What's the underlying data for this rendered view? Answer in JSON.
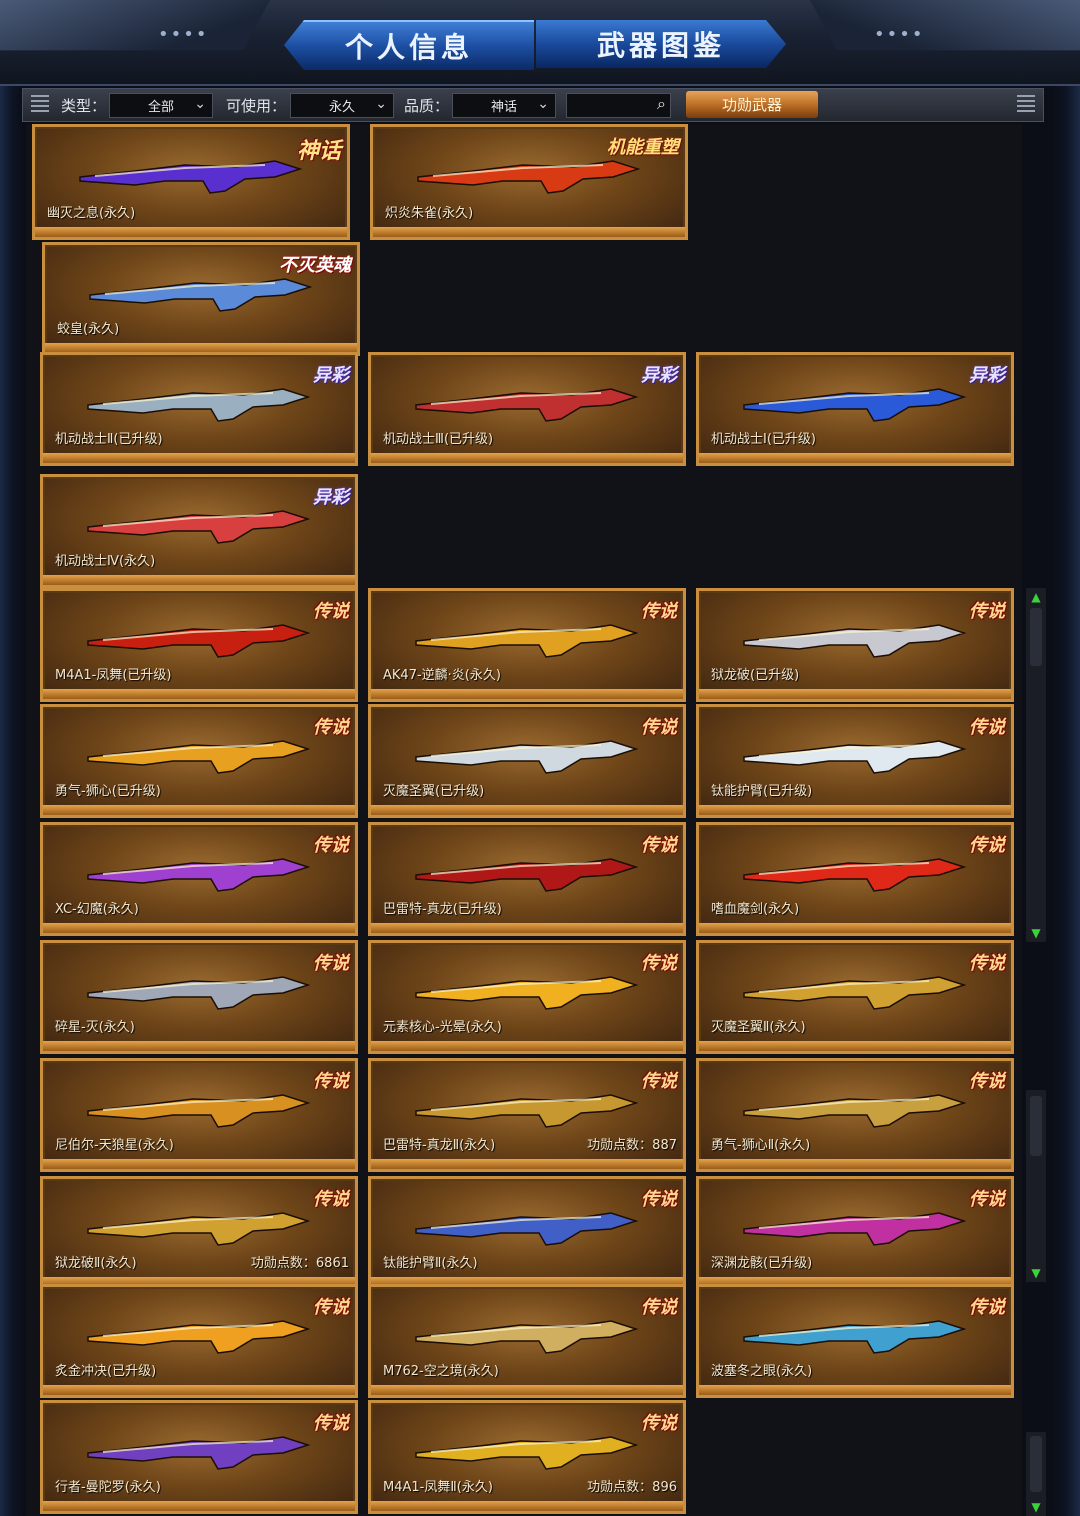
{
  "tabs": [
    {
      "label": "个人信息"
    },
    {
      "label": "武器图鉴"
    }
  ],
  "filters": {
    "type_label": "类型：",
    "type_value": "全部",
    "usable_label": "可使用：",
    "usable_value": "永久",
    "quality_label": "品质：",
    "quality_value": "神话",
    "search_value": "",
    "merit_button": "功勋武器"
  },
  "header_dots": "••••",
  "cards": [
    {
      "name": "幽灭之息(永久)",
      "badge": "神话",
      "badge_style": "myth",
      "merit": "",
      "color": "#5a2fd0"
    },
    {
      "name": "炽炎朱雀(永久)",
      "badge": "机能重塑",
      "badge_style": "mech",
      "merit": "",
      "color": "#d83a14"
    },
    {
      "name": "蛟皇(永久)",
      "badge": "不灭英魂",
      "badge_style": "bm",
      "merit": "",
      "color": "#5a8ad8"
    },
    {
      "name": "机动战士Ⅱ(已升级)",
      "badge": "异彩",
      "badge_style": "yc",
      "merit": "",
      "color": "#9ab0c0"
    },
    {
      "name": "机动战士Ⅲ(已升级)",
      "badge": "异彩",
      "badge_style": "yc",
      "merit": "",
      "color": "#c03030"
    },
    {
      "name": "机动战士Ⅰ(已升级)",
      "badge": "异彩",
      "badge_style": "yc",
      "merit": "",
      "color": "#2a5ad8"
    },
    {
      "name": "机动战士Ⅳ(永久)",
      "badge": "异彩",
      "badge_style": "yc",
      "merit": "",
      "color": "#d84040"
    },
    {
      "name": "M4A1-凤舞(已升级)",
      "badge": "传说",
      "badge_style": "",
      "merit": "",
      "color": "#c82010"
    },
    {
      "name": "AK47-逆麟·炎(永久)",
      "badge": "传说",
      "badge_style": "",
      "merit": "",
      "color": "#e0a020"
    },
    {
      "name": "狱龙破(已升级)",
      "badge": "传说",
      "badge_style": "",
      "merit": "",
      "color": "#c8c8d0"
    },
    {
      "name": "勇气-狮心(已升级)",
      "badge": "传说",
      "badge_style": "",
      "merit": "",
      "color": "#e8a020"
    },
    {
      "name": "灭魔圣翼(已升级)",
      "badge": "传说",
      "badge_style": "",
      "merit": "",
      "color": "#d0d8e0"
    },
    {
      "name": "钛能护臂(已升级)",
      "badge": "传说",
      "badge_style": "",
      "merit": "",
      "color": "#e0e8f0"
    },
    {
      "name": "XC-幻魔(永久)",
      "badge": "传说",
      "badge_style": "",
      "merit": "",
      "color": "#a040d0"
    },
    {
      "name": "巴雷特-真龙(已升级)",
      "badge": "传说",
      "badge_style": "",
      "merit": "",
      "color": "#b01818"
    },
    {
      "name": "嗜血魔剑(永久)",
      "badge": "传说",
      "badge_style": "",
      "merit": "",
      "color": "#e02818"
    },
    {
      "name": "碎星-灭(永久)",
      "badge": "传说",
      "badge_style": "",
      "merit": "",
      "color": "#a0a8b8"
    },
    {
      "name": "元素核心-光晕(永久)",
      "badge": "传说",
      "badge_style": "",
      "merit": "",
      "color": "#f0b020"
    },
    {
      "name": "灭魔圣翼Ⅱ(永久)",
      "badge": "传说",
      "badge_style": "",
      "merit": "",
      "color": "#d0a030"
    },
    {
      "name": "尼伯尔-天狼星(永久)",
      "badge": "传说",
      "badge_style": "",
      "merit": "",
      "color": "#d89020"
    },
    {
      "name": "巴雷特-真龙Ⅱ(永久)",
      "badge": "传说",
      "badge_style": "",
      "merit": "功勋点数：887",
      "color": "#c89830"
    },
    {
      "name": "勇气-狮心Ⅱ(永久)",
      "badge": "传说",
      "badge_style": "",
      "merit": "",
      "color": "#c8a040"
    },
    {
      "name": "狱龙破Ⅱ(永久)",
      "badge": "传说",
      "badge_style": "",
      "merit": "功勋点数：6861",
      "color": "#d0a030"
    },
    {
      "name": "钛能护臂Ⅱ(永久)",
      "badge": "传说",
      "badge_style": "",
      "merit": "",
      "color": "#4060c8"
    },
    {
      "name": "深渊龙骸(已升级)",
      "badge": "传说",
      "badge_style": "",
      "merit": "",
      "color": "#c030a0"
    },
    {
      "name": "炙金冲决(已升级)",
      "badge": "传说",
      "badge_style": "",
      "merit": "",
      "color": "#f0a020"
    },
    {
      "name": "M762-空之境(永久)",
      "badge": "传说",
      "badge_style": "",
      "merit": "",
      "color": "#d0b060"
    },
    {
      "name": "波塞冬之眼(永久)",
      "badge": "传说",
      "badge_style": "",
      "merit": "",
      "color": "#40a0d0"
    },
    {
      "name": "行者-曼陀罗(永久)",
      "badge": "传说",
      "badge_style": "",
      "merit": "",
      "color": "#7040c0"
    },
    {
      "name": "M4A1-凤舞Ⅱ(永久)",
      "badge": "传说",
      "badge_style": "",
      "merit": "功勋点数：896",
      "color": "#e0b020"
    }
  ]
}
